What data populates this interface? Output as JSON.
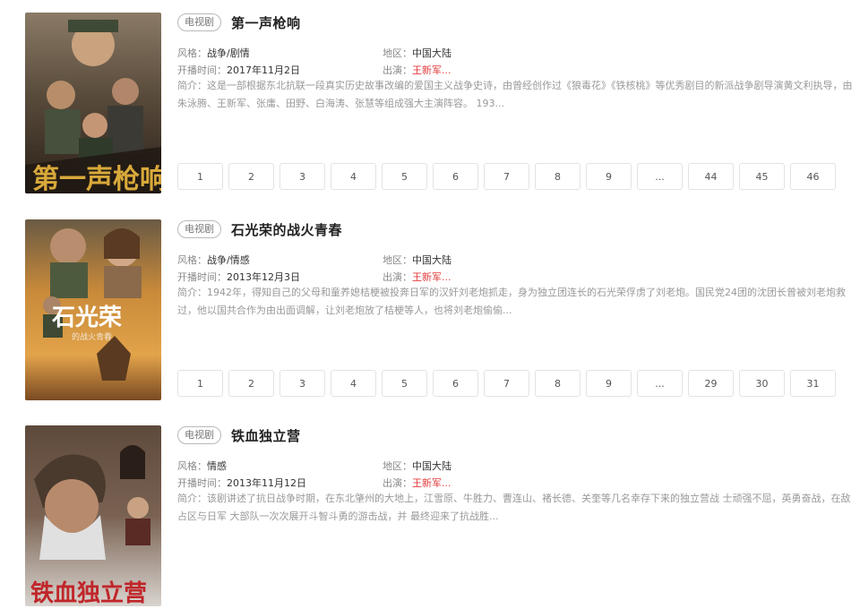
{
  "labels": {
    "style": "风格：",
    "region": "地区：",
    "air_date": "开播时间：",
    "cast": "出演：",
    "summary": "简介："
  },
  "dramas": [
    {
      "tag": "电视剧",
      "title": "第一声枪响",
      "style": "战争/剧情",
      "region": "中国大陆",
      "air_date": "2017年11月2日",
      "cast": "王新军...",
      "summary": "这是一部根据东北抗联一段真实历史故事改编的爱国主义战争史诗，由曾经创作过《狼毒花》《铁核桃》等优秀剧目的新派战争剧导演黄文利执导，由朱泳腾、王新军、张庸、田野、白海涛、张慧等组成强大主演阵容。 193...",
      "poster_text": "第一声枪响",
      "pages": [
        "1",
        "2",
        "3",
        "4",
        "5",
        "6",
        "7",
        "8",
        "9",
        "...",
        "44",
        "45",
        "46"
      ]
    },
    {
      "tag": "电视剧",
      "title": "石光荣的战火青春",
      "style": "战争/情感",
      "region": "中国大陆",
      "air_date": "2013年12月3日",
      "cast": "王新军...",
      "summary": "1942年，得知自己的父母和童养媳桔梗被投奔日军的汉奸刘老炮抓走，身为独立团连长的石光荣俘虏了刘老炮。国民党24团的沈团长曾被刘老炮救过，他以国共合作为由出面调解，让刘老炮放了桔梗等人，也将刘老炮偷偷...",
      "poster_text": "石光荣",
      "poster_subtext": "的战火青春",
      "pages": [
        "1",
        "2",
        "3",
        "4",
        "5",
        "6",
        "7",
        "8",
        "9",
        "...",
        "29",
        "30",
        "31"
      ]
    },
    {
      "tag": "电视剧",
      "title": "铁血独立营",
      "style": "情感",
      "region": "中国大陆",
      "air_date": "2013年11月12日",
      "cast": "王新军...",
      "summary": "该剧讲述了抗日战争时期，在东北肇州的大地上，江雪原、牛胜力、曹连山、褚长德、关奎等几名幸存下来的独立营战 士顽强不屈，英勇奋战，在敌占区与日军 大部队一次次展开斗智斗勇的游击战，并 最终迎来了抗战胜...",
      "poster_text": "铁血独立营",
      "pages": []
    }
  ],
  "colors": {
    "cast_link": "#e23c3c",
    "label_gray": "#888888",
    "summary_gray": "#999999",
    "page_border": "#e3e3e3"
  }
}
